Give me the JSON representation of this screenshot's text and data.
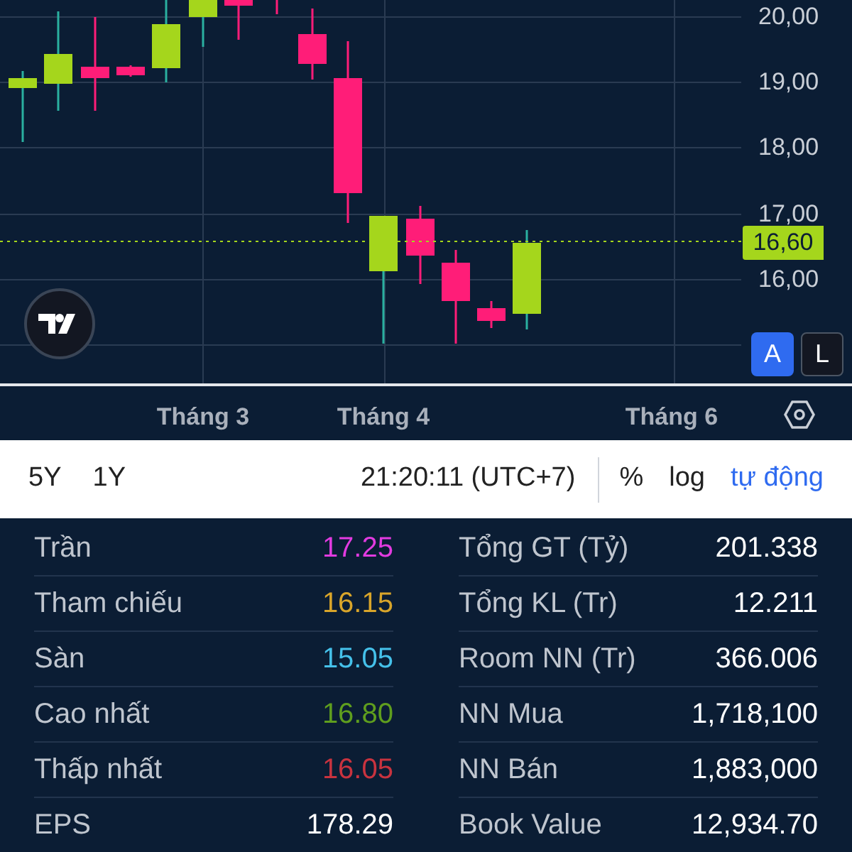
{
  "chart": {
    "y_axis_labels": [
      "20,00",
      "19,00",
      "18,00",
      "17,00",
      "16,00"
    ],
    "price_tag": "16,60",
    "scale_buttons": [
      {
        "label": "A",
        "selected": true
      },
      {
        "label": "L",
        "selected": false
      }
    ],
    "x_axis_labels": [
      "Tháng 3",
      "Tháng 4",
      "Tháng 6"
    ]
  },
  "toolbar": {
    "ranges": [
      "5Y",
      "1Y"
    ],
    "clock": "21:20:11 (UTC+7)",
    "options": [
      {
        "label": "%",
        "selected": false
      },
      {
        "label": "log",
        "selected": false
      },
      {
        "label": "tự động",
        "selected": true
      }
    ]
  },
  "stats": {
    "left": [
      {
        "label": "Trần",
        "value": "17.25",
        "color": "#e23be0"
      },
      {
        "label": "Tham chiếu",
        "value": "16.15",
        "color": "#d9a52a"
      },
      {
        "label": "Sàn",
        "value": "15.05",
        "color": "#45c1ea"
      },
      {
        "label": "Cao nhất",
        "value": "16.80",
        "color": "#5f9e1e"
      },
      {
        "label": "Thấp nhất",
        "value": "16.05",
        "color": "#c8333f"
      },
      {
        "label": "EPS",
        "value": "178.29",
        "color": "#ffffff"
      }
    ],
    "right": [
      {
        "label": "Tổng GT (Tỷ)",
        "value": "201.338"
      },
      {
        "label": "Tổng KL (Tr)",
        "value": "12.211"
      },
      {
        "label": "Room NN (Tr)",
        "value": "366.006"
      },
      {
        "label": "NN Mua",
        "value": "1,718,100"
      },
      {
        "label": "NN Bán",
        "value": "1,883,000"
      },
      {
        "label": "Book Value",
        "value": "12,934.70"
      }
    ]
  }
}
